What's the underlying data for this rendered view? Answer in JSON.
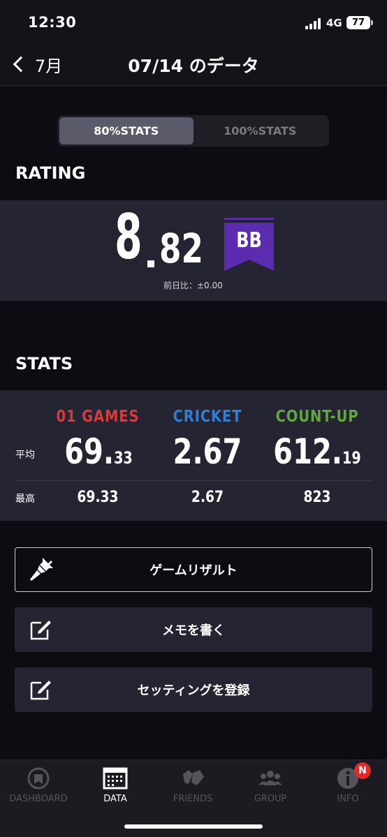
{
  "status_bar": {
    "time": "12:30",
    "network": "4G",
    "battery": "77"
  },
  "nav": {
    "back_label": "7月",
    "title": "07/14 のデータ"
  },
  "segments": [
    "80%STATS",
    "100%STATS"
  ],
  "rating": {
    "section_title": "RATING",
    "integer": "8",
    "decimal": "82",
    "diff": "前日比：±0.00",
    "class_badge": "BB",
    "badge_color": "#5b2bb0"
  },
  "stats": {
    "section_title": "STATS",
    "row_labels": {
      "avg": "平均",
      "max": "最高"
    },
    "columns": [
      {
        "name": "01 GAMES",
        "color": "#d83a3a",
        "avg_int": "69.",
        "avg_dec": "33",
        "max": "69.33"
      },
      {
        "name": "CRICKET",
        "color": "#2f7fd6",
        "avg_int": "2.67",
        "avg_dec": "",
        "max": "2.67"
      },
      {
        "name": "COUNT-UP",
        "color": "#5fa83a",
        "avg_int": "612.",
        "avg_dec": "19",
        "max": "823"
      }
    ]
  },
  "actions": [
    {
      "label": "ゲームリザルト",
      "icon": "dart-icon"
    },
    {
      "label": "メモを書く",
      "icon": "edit-icon"
    },
    {
      "label": "セッティングを登録",
      "icon": "edit-icon"
    }
  ],
  "tabs": [
    {
      "label": "DASHBOARD",
      "icon": "dashboard-icon"
    },
    {
      "label": "DATA",
      "icon": "data-icon"
    },
    {
      "label": "FRIENDS",
      "icon": "friends-icon"
    },
    {
      "label": "GROUP",
      "icon": "group-icon"
    },
    {
      "label": "INFO",
      "icon": "info-icon"
    }
  ],
  "info_badge": "N"
}
